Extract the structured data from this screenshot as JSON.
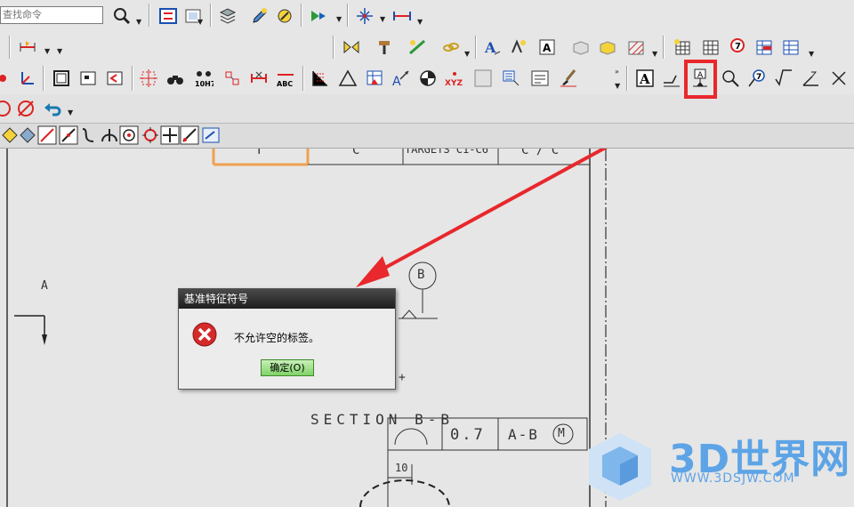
{
  "search": {
    "placeholder": "查找命令"
  },
  "drawing": {
    "table_top": [
      "T",
      "C",
      "TARGETS C1-C6",
      "C / C"
    ],
    "label_a": "A",
    "datum_b": "B",
    "section_label": "SECTION B-B",
    "fcf_tolerance": "0.7",
    "fcf_datum": "A-B",
    "fcf_modifier": "M",
    "dimension": "10",
    "plus_mark": "+"
  },
  "toolbar": {
    "text_button": "A",
    "dim_label": "ABC",
    "fit_label": "10H7",
    "xyz_label": "XYZ"
  },
  "dialog": {
    "title": "基准特征符号",
    "message": "不允许空的标签。",
    "ok_label": "确定(O)"
  },
  "watermark": {
    "brand": "3D世界网",
    "url": "WWW.3DSJW.COM"
  },
  "colors": {
    "accent": "#e8282c",
    "logo": "#5da4e6",
    "ok_green": "#7fd267"
  }
}
